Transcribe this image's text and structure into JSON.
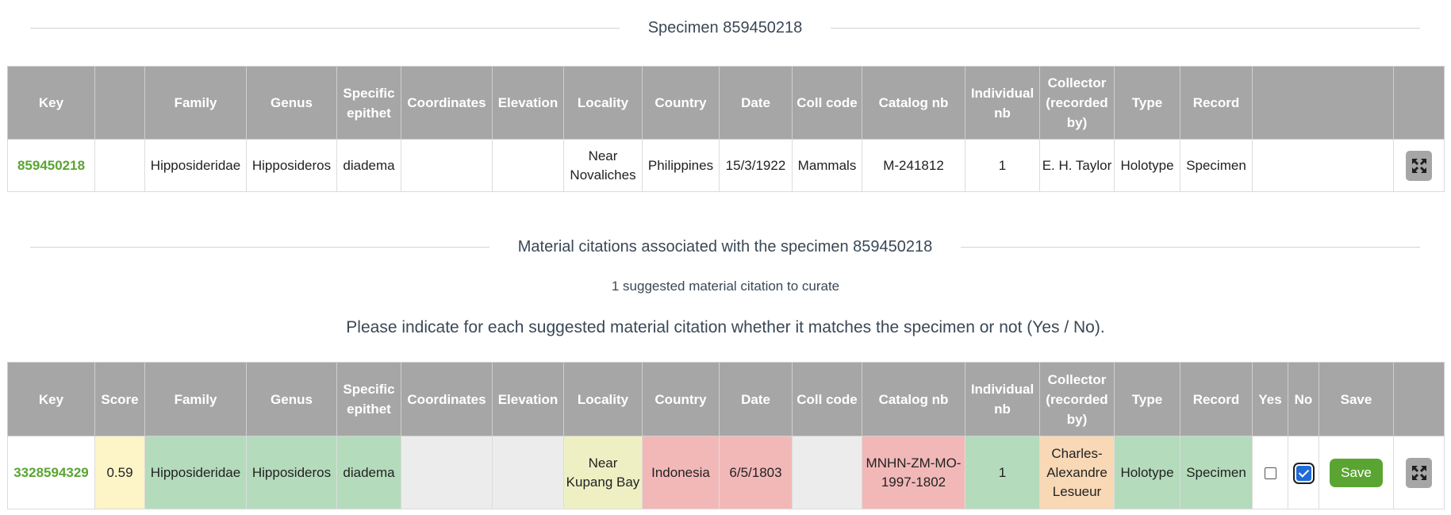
{
  "specimen_section": {
    "title": "Specimen 859450218"
  },
  "specimen_table": {
    "headers": {
      "key": "Key",
      "blank": "",
      "family": "Family",
      "genus": "Genus",
      "specific_epithet": "Specific epithet",
      "coordinates": "Coordinates",
      "elevation": "Elevation",
      "locality": "Locality",
      "country": "Country",
      "date": "Date",
      "coll_code": "Coll code",
      "catalog_nb": "Catalog nb",
      "individual_nb": "Individual nb",
      "collector": "Collector (recorded by)",
      "type": "Type",
      "record": "Record"
    },
    "row": {
      "key": "859450218",
      "blank": "",
      "family": "Hipposideridae",
      "genus": "Hipposideros",
      "specific_epithet": "diadema",
      "coordinates": "",
      "elevation": "",
      "locality": "Near Novaliches",
      "country": "Philippines",
      "date": "15/3/1922",
      "coll_code": "Mammals",
      "catalog_nb": "M-241812",
      "individual_nb": "1",
      "collector": "E. H. Taylor",
      "type": "Holotype",
      "record": "Specimen",
      "extra": ""
    }
  },
  "citations_section": {
    "title": "Material citations associated with the specimen 859450218",
    "subtitle": "1 suggested material citation to curate",
    "instruction": "Please indicate for each suggested material citation whether it matches the specimen or not (Yes / No)."
  },
  "citation_table": {
    "headers": {
      "key": "Key",
      "score": "Score",
      "family": "Family",
      "genus": "Genus",
      "specific_epithet": "Specific epithet",
      "coordinates": "Coordinates",
      "elevation": "Elevation",
      "locality": "Locality",
      "country": "Country",
      "date": "Date",
      "coll_code": "Coll code",
      "catalog_nb": "Catalog nb",
      "individual_nb": "Individual nb",
      "collector": "Collector (recorded by)",
      "type": "Type",
      "record": "Record",
      "yes": "Yes",
      "no": "No",
      "save": "Save"
    },
    "row": {
      "key": "3328594329",
      "score": "0.59",
      "family": "Hipposideridae",
      "genus": "Hipposideros",
      "specific_epithet": "diadema",
      "coordinates": "",
      "elevation": "",
      "locality": "Near Kupang Bay",
      "country": "Indonesia",
      "date": "6/5/1803",
      "coll_code": "",
      "catalog_nb": "MNHN-ZM-MO-1997-1802",
      "individual_nb": "1",
      "collector": "Charles-Alexandre Lesueur",
      "type": "Holotype",
      "record": "Specimen",
      "yes_checked": false,
      "no_checked": true,
      "save_label": "Save"
    }
  },
  "icons": {
    "expand": "expand-arrows-icon"
  },
  "colors": {
    "header_bg": "#a6a6a6",
    "key_link": "#5aa532",
    "match": "#b4dbbb",
    "mismatch": "#f2b8b8",
    "partial": "#eef0c3",
    "score": "#fdf4c7",
    "collector_partial": "#f8d8b5",
    "missing": "#ececec",
    "save_button": "#5aa532"
  }
}
